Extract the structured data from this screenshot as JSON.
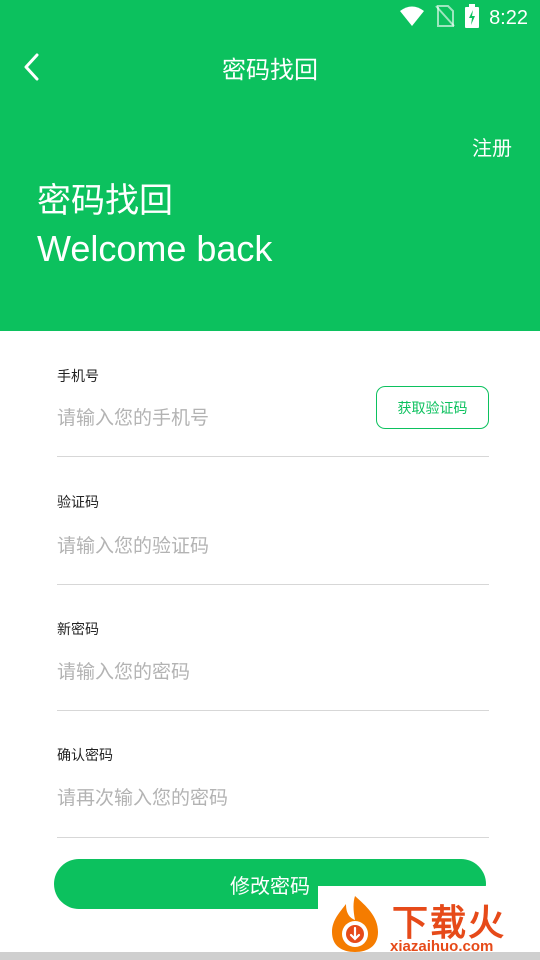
{
  "status_bar": {
    "time": "8:22",
    "icons": [
      "wifi-icon",
      "no-sim-icon",
      "battery-charging-icon"
    ]
  },
  "nav": {
    "back_icon": "back-chevron-icon",
    "title": "密码找回"
  },
  "header": {
    "register_label": "注册",
    "hero_title": "密码找回",
    "hero_subtitle": "Welcome back",
    "background_color": "#0cc15e"
  },
  "form": {
    "phone": {
      "label": "手机号",
      "placeholder": "请输入您的手机号",
      "value": ""
    },
    "get_code_label": "获取验证码",
    "code": {
      "label": "验证码",
      "placeholder": "请输入您的验证码",
      "value": ""
    },
    "new_password": {
      "label": "新密码",
      "placeholder": "请输入您的密码",
      "value": ""
    },
    "confirm_password": {
      "label": "确认密码",
      "placeholder": "请再次输入您的密码",
      "value": ""
    },
    "submit_label": "修改密码"
  },
  "watermark": {
    "brand": "下载火",
    "site": "xiazaihuo.com"
  },
  "colors": {
    "accent": "#0cc15e",
    "watermark": "#e64a19"
  }
}
